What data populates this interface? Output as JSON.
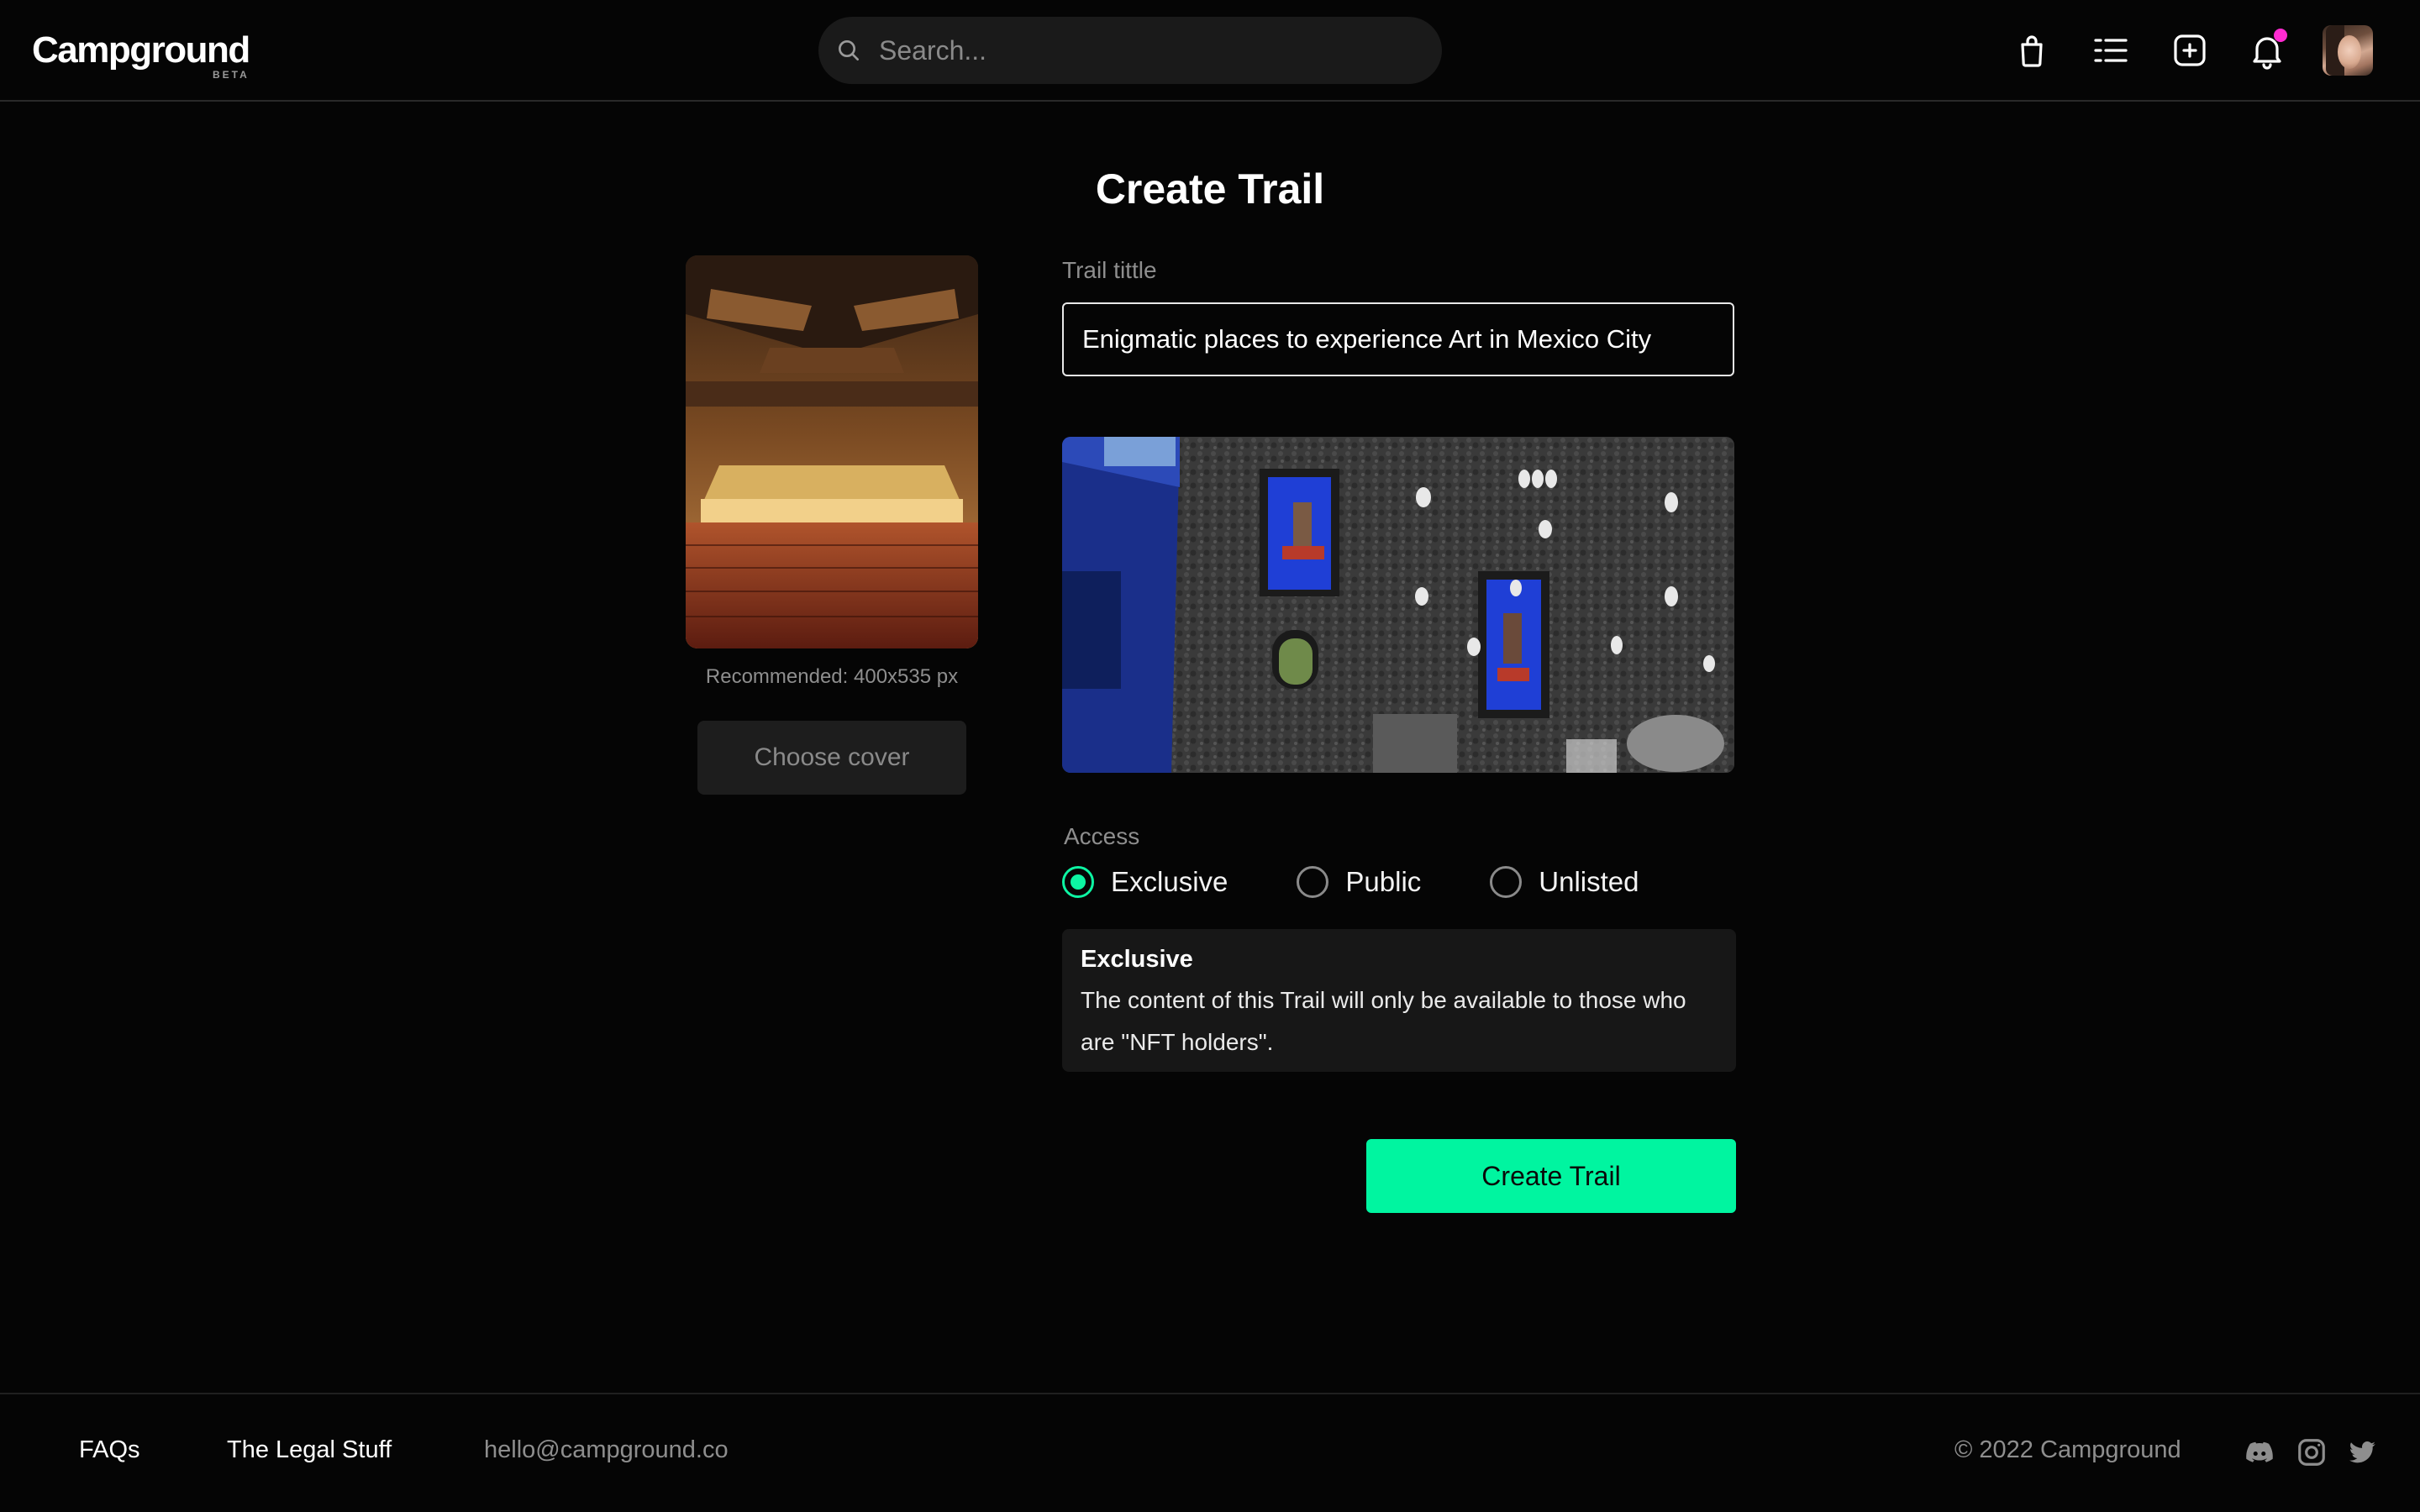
{
  "header": {
    "logo": "Campground",
    "logo_badge": "BETA",
    "search_placeholder": "Search...",
    "icons": [
      "shopping-bag-icon",
      "list-icon",
      "add-square-icon",
      "bell-icon"
    ],
    "has_notification": true
  },
  "main": {
    "title": "Create Trail",
    "cover": {
      "recommendation": "Recommended: 400x535 px",
      "button_label": "Choose cover"
    },
    "trail_title": {
      "label": "Trail tittle",
      "value": "Enigmatic places to experience Art in Mexico City"
    },
    "access": {
      "label": "Access",
      "options": [
        "Exclusive",
        "Public",
        "Unlisted"
      ],
      "selected": "Exclusive"
    },
    "info": {
      "title": "Exclusive",
      "description_line1": "The content of this Trail will only be available to those who",
      "description_line2": "are \"NFT holders\"."
    },
    "submit_label": "Create Trail"
  },
  "footer": {
    "links": [
      "FAQs",
      "The Legal Stuff"
    ],
    "email": "hello@campground.co",
    "copyright": "© 2022 Campground",
    "social_icons": [
      "discord-icon",
      "instagram-icon",
      "twitter-icon"
    ]
  },
  "colors": {
    "background": "#050505",
    "accent": "#00f5a0",
    "notification": "#ff2bd1"
  }
}
